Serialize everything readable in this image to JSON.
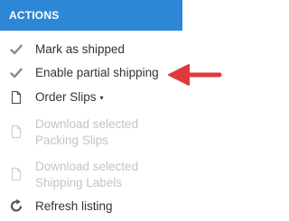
{
  "header": {
    "title": "ACTIONS"
  },
  "menu": {
    "items": [
      {
        "label": "Mark as shipped",
        "icon": "checkmark-icon",
        "disabled": false
      },
      {
        "label": "Enable partial shipping",
        "icon": "checkmark-icon",
        "disabled": false
      },
      {
        "label": "Order Slips",
        "icon": "document-icon",
        "disabled": false,
        "caret": "▾"
      },
      {
        "label_line1": "Download selected",
        "label_line2": "Packing Slips",
        "icon": "document-icon",
        "disabled": true
      },
      {
        "label_line1": "Download selected",
        "label_line2": "Shipping Labels",
        "icon": "document-icon",
        "disabled": true
      },
      {
        "label": "Refresh listing",
        "icon": "refresh-icon",
        "disabled": false
      }
    ]
  },
  "colors": {
    "header_bg": "#2e86d6",
    "text": "#333333",
    "disabled_text": "#c4c4c4",
    "annotation_arrow": "#e0393e"
  }
}
